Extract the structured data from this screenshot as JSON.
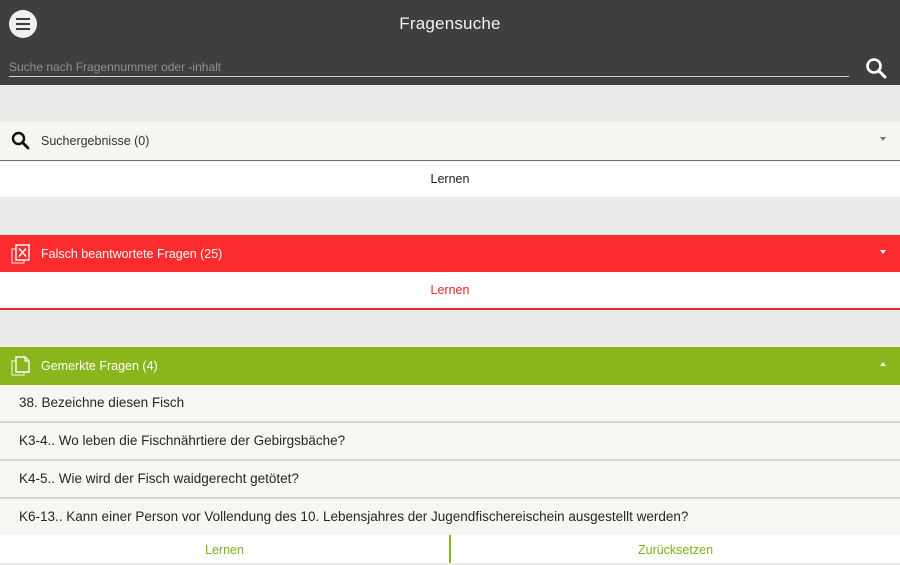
{
  "appbar": {
    "title": "Fragensuche",
    "menu_icon": "hamburger-menu-icon",
    "search_icon": "search-icon"
  },
  "search": {
    "placeholder": "Suche nach Fragennummer oder -inhalt",
    "value": ""
  },
  "sections": {
    "results": {
      "label": "Suchergebnisse (0)",
      "icon": "search-icon",
      "expanded": false,
      "learn_label": "Lernen"
    },
    "wrong": {
      "label": "Falsch beantwortete Fragen (25)",
      "icon": "wrong-questions-icon",
      "color": "#fc2b2d",
      "expanded": false,
      "learn_label": "Lernen"
    },
    "bookmarked": {
      "label": "Gemerkte Fragen (4)",
      "icon": "bookmarked-questions-icon",
      "color": "#8ab51c",
      "expanded": true,
      "items": [
        "38. Bezeichne diesen Fisch",
        "K3-4.. Wo leben die Fischnährtiere der Gebirgsbäche?",
        "K4-5.. Wie wird der Fisch waidgerecht getötet?",
        "K6-13.. Kann einer Person vor Vollendung des 10. Lebensjahres der Jugendfischereischein ausgestellt werden?"
      ]
    }
  },
  "bottom": {
    "learn_label": "Lernen",
    "reset_label": "Zurücksetzen"
  }
}
